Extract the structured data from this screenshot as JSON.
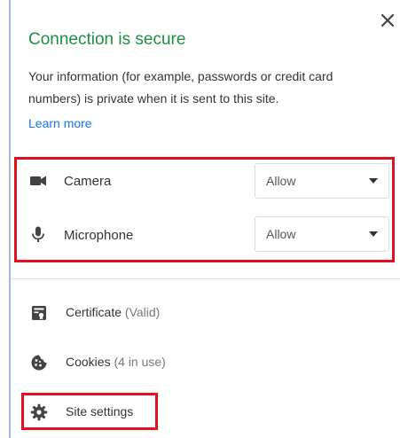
{
  "header": {
    "title": "Connection is secure",
    "close_icon": "close-icon"
  },
  "info": {
    "description": "Your information (for example, passwords or credit card numbers) is private when it is sent to this site.",
    "learn_more": "Learn more"
  },
  "permissions": [
    {
      "label": "Camera",
      "icon": "camera-icon",
      "value": "Allow"
    },
    {
      "label": "Microphone",
      "icon": "microphone-icon",
      "value": "Allow"
    }
  ],
  "rows": [
    {
      "label": "Certificate",
      "extra": "(Valid)",
      "icon": "certificate-icon"
    },
    {
      "label": "Cookies",
      "extra": "(4 in use)",
      "icon": "cookie-icon"
    },
    {
      "label": "Site settings",
      "icon": "gear-icon"
    }
  ],
  "colors": {
    "secure_green": "#1e8e3e",
    "link_blue": "#1a73e8",
    "highlight_red": "#e0101e"
  }
}
